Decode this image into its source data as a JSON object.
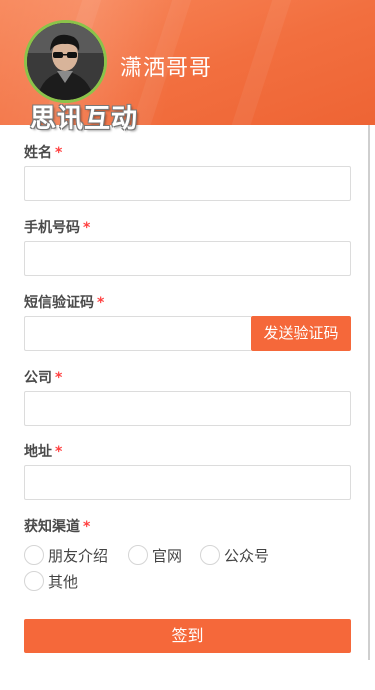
{
  "header": {
    "username": "潇洒哥哥",
    "watermark": "思讯互动"
  },
  "form": {
    "required_mark": "*",
    "fields": {
      "name": {
        "label": "姓名",
        "value": ""
      },
      "phone": {
        "label": "手机号码",
        "value": ""
      },
      "code": {
        "label": "短信验证码",
        "value": "",
        "send_button": "发送验证码"
      },
      "company": {
        "label": "公司",
        "value": ""
      },
      "address": {
        "label": "地址",
        "value": ""
      }
    },
    "channel": {
      "label": "获知渠道",
      "options": [
        "朋友介绍",
        "官网",
        "公众号",
        "其他"
      ]
    },
    "submit_label": "签到"
  },
  "colors": {
    "accent": "#f5683a",
    "avatar_border": "#8bc34a",
    "required": "#ff4040"
  },
  "icons": {
    "avatar": "user-avatar-photo"
  }
}
